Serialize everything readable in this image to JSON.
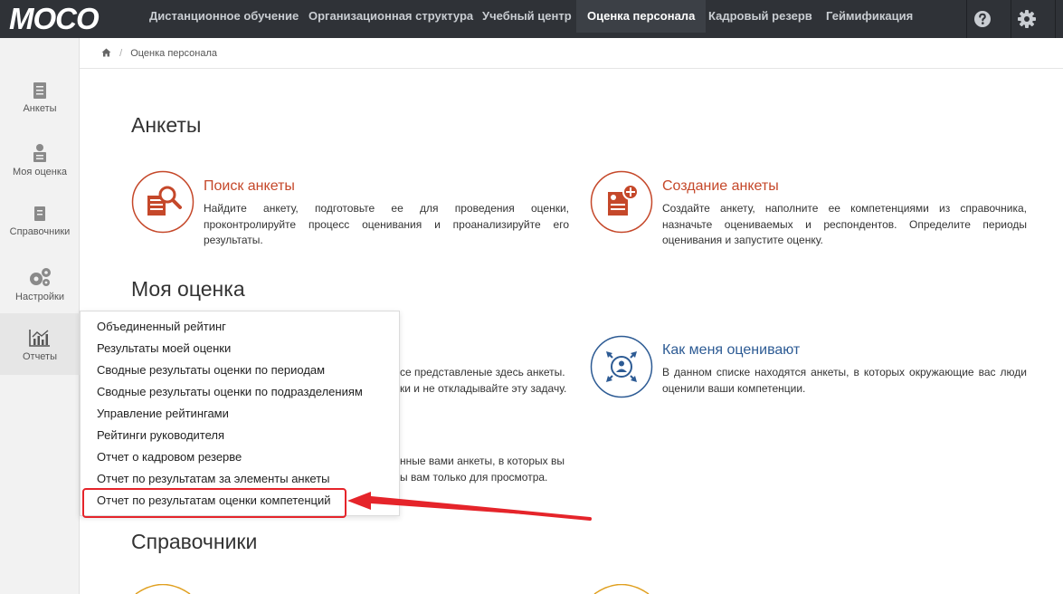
{
  "logo": {
    "text": "MOCO"
  },
  "nav": {
    "items": [
      {
        "label": "Дистанционное обучение"
      },
      {
        "label": "Организационная структура"
      },
      {
        "label": "Учебный центр"
      },
      {
        "label": "Оценка персонала"
      },
      {
        "label": "Кадровый резерв"
      },
      {
        "label": "Геймификация"
      }
    ],
    "active_index": 3,
    "help_icon": "question-icon",
    "settings_icon": "gear-icon"
  },
  "sidebar": {
    "items": [
      {
        "label": "Анкеты",
        "icon": "survey-icon"
      },
      {
        "label": "Моя оценка",
        "icon": "my-assessment-icon"
      },
      {
        "label": "Справочники",
        "icon": "book-icon"
      },
      {
        "label": "Настройки",
        "icon": "gears-icon"
      },
      {
        "label": "Отчеты",
        "icon": "chart-icon"
      }
    ],
    "active_index": 4
  },
  "breadcrumb": {
    "home_icon": "home-icon",
    "separator": "/",
    "current": "Оценка персонала"
  },
  "sections": {
    "surveys": {
      "title": "Анкеты",
      "cards": [
        {
          "title": "Поиск анкеты",
          "desc": "Найдите анкету, подготовьте ее для проведения оценки, проконтролируйте процесс оценивания и проанализируйте его результаты.",
          "icon": "search-survey-icon"
        },
        {
          "title": "Создание анкеты",
          "desc": "Создайте анкету, наполните ее компетенциями из справочника, назначьте оцениваемых и респондентов. Определите периоды оценивания и запустите оценку.",
          "icon": "create-survey-icon"
        }
      ]
    },
    "my_assessment": {
      "title": "Моя оценка",
      "partial_desc_1_line1": "се представленые здесь анкеты.",
      "partial_desc_1_line2": "ки и не откладывайте эту задачу.",
      "card_right": {
        "title": "Как меня оценивают",
        "desc": "В данном списке находятся анкеты, в которых окружающие вас люди оценили ваши компетенции.",
        "icon": "people-arrows-icon"
      },
      "partial_desc_2_line1": "нные вами анкеты, в которых вы",
      "partial_desc_2_line2": "ы вам только для просмотра."
    },
    "directories": {
      "title": "Справочники"
    }
  },
  "reports_menu": {
    "items": [
      "Объединенный рейтинг",
      "Результаты моей оценки",
      "Сводные результаты оценки по периодам",
      "Сводные результаты оценки по подразделениям",
      "Управление рейтингами",
      "Рейтинги руководителя",
      "Отчет о кадровом резерве",
      "Отчет по результатам за элементы анкеты",
      "Отчет по результатам оценки компетенций"
    ],
    "highlighted_index": 8
  },
  "colors": {
    "topbar": "#2f3237",
    "accent_orange": "#c5482a",
    "accent_blue": "#2d5b94",
    "highlight_red": "#e5242a"
  }
}
